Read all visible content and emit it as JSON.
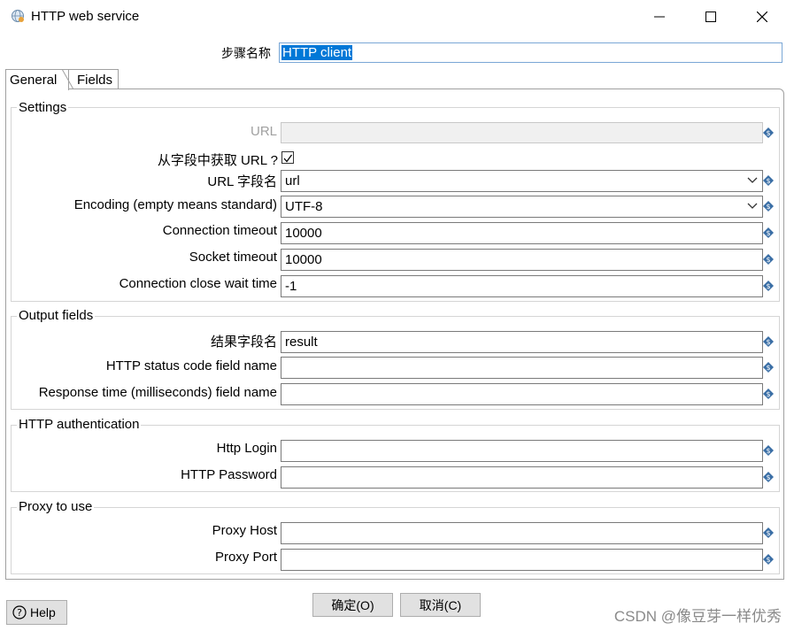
{
  "window": {
    "title": "HTTP web service",
    "controls": [
      "minimize",
      "maximize",
      "close"
    ]
  },
  "step": {
    "label": "步骤名称",
    "value": "HTTP client"
  },
  "tabs": [
    {
      "label": "General",
      "active": true
    },
    {
      "label": "Fields",
      "active": false
    }
  ],
  "settings": {
    "title": "Settings",
    "url_label": "URL",
    "url_value": "",
    "from_field_label": "从字段中获取 URL ?",
    "from_field_checked": true,
    "url_field_label": "URL 字段名",
    "url_field_value": "url",
    "encoding_label": "Encoding (empty means standard)",
    "encoding_value": "UTF-8",
    "conn_timeout_label": "Connection timeout",
    "conn_timeout_value": "10000",
    "socket_timeout_label": "Socket timeout",
    "socket_timeout_value": "10000",
    "close_wait_label": "Connection close wait time",
    "close_wait_value": "-1"
  },
  "output": {
    "title": "Output fields",
    "result_label": "结果字段名",
    "result_value": "result",
    "status_label": "HTTP status code field name",
    "status_value": "",
    "resp_time_label": "Response time (milliseconds) field name",
    "resp_time_value": ""
  },
  "auth": {
    "title": "HTTP authentication",
    "login_label": "Http Login",
    "login_value": "",
    "password_label": "HTTP Password",
    "password_value": ""
  },
  "proxy": {
    "title": "Proxy to use",
    "host_label": "Proxy Host",
    "host_value": "",
    "port_label": "Proxy Port",
    "port_value": ""
  },
  "footer": {
    "help_label": "Help",
    "ok_label": "确定(O)",
    "cancel_label": "取消(C)",
    "watermark": "CSDN @像豆芽一样优秀"
  },
  "colors": {
    "selection": "#0078d7",
    "variable_icon": "#3a6ea5"
  }
}
